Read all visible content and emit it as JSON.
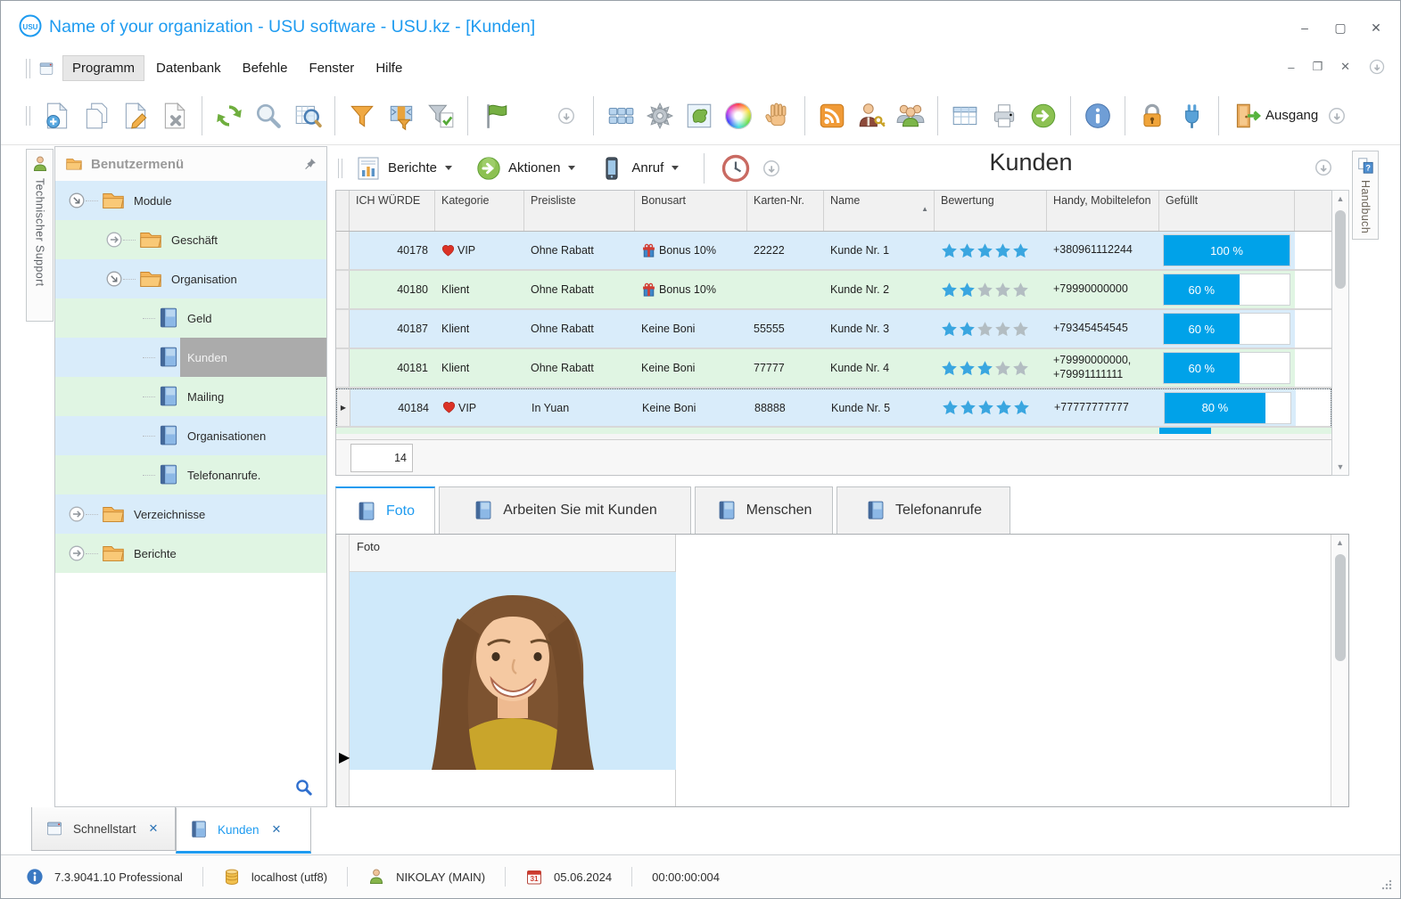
{
  "window": {
    "title": "Name of your organization - USU software - USU.kz - [Kunden]",
    "logo": "USU",
    "controls": {
      "minimize": "–",
      "maximize": "▢",
      "close": "✕"
    }
  },
  "menubar": {
    "items": [
      {
        "label": "Programm",
        "active": true
      },
      {
        "label": "Datenbank"
      },
      {
        "label": "Befehle"
      },
      {
        "label": "Fenster"
      },
      {
        "label": "Hilfe"
      }
    ]
  },
  "toolbar": {
    "items": [
      "new-record",
      "copy-record",
      "edit-record",
      "delete-record",
      "|",
      "refresh",
      "search",
      "search-table",
      "|",
      "filter",
      "filter-columns",
      "filter-apply",
      "|",
      "flag",
      "gap",
      "dropdown-circle",
      "|",
      "tiles",
      "gear",
      "map-image",
      "color-wheel",
      "hand",
      "|",
      "rss-feed",
      "user-key",
      "user-group",
      "|",
      "table-view",
      "print",
      "go-next",
      "|",
      "info",
      "|",
      "lock",
      "plug",
      "|",
      "exit-door"
    ],
    "exit_label": "Ausgang"
  },
  "support_tab": {
    "label": "Technischer Support"
  },
  "handbuch_tab": {
    "label": "Handbuch"
  },
  "sidebar": {
    "header": "Benutzermenü",
    "tree": [
      {
        "label": "Module",
        "icon": "folder",
        "level": 0,
        "expander": "expanded",
        "tone": "blue"
      },
      {
        "label": "Geschäft",
        "icon": "folder",
        "level": 1,
        "expander": "collapsed",
        "tone": "green"
      },
      {
        "label": "Organisation",
        "icon": "folder",
        "level": 1,
        "expander": "expanded",
        "tone": "blue"
      },
      {
        "label": "Geld",
        "icon": "book",
        "level": 2,
        "tone": "green"
      },
      {
        "label": "Kunden",
        "icon": "book",
        "level": 2,
        "tone": "blue",
        "selected": true
      },
      {
        "label": "Mailing",
        "icon": "book",
        "level": 2,
        "tone": "green"
      },
      {
        "label": "Organisationen",
        "icon": "book",
        "level": 2,
        "tone": "blue"
      },
      {
        "label": "Telefonanrufe.",
        "icon": "book",
        "level": 2,
        "tone": "green"
      },
      {
        "label": "Verzeichnisse",
        "icon": "folder",
        "level": 0,
        "expander": "collapsed",
        "tone": "blue"
      },
      {
        "label": "Berichte",
        "icon": "folder",
        "level": 0,
        "expander": "collapsed",
        "tone": "green"
      }
    ]
  },
  "content": {
    "heading": "Kunden",
    "actions": [
      {
        "label": "Berichte",
        "icon": "report"
      },
      {
        "label": "Aktionen",
        "icon": "action-go"
      },
      {
        "label": "Anruf",
        "icon": "phone"
      }
    ],
    "table": {
      "columns": [
        "ICH WÜRDE",
        "Kategorie",
        "Preisliste",
        "Bonusart",
        "Karten-Nr.",
        "Name",
        "Bewertung",
        "Handy, Mobiltelefon",
        "Gefüllt"
      ],
      "sorted_by": "Name",
      "rows": [
        {
          "id": "40178",
          "heart": true,
          "kategorie": "VIP",
          "preisliste": "Ohne Rabatt",
          "gift": true,
          "bonusart": "Bonus 10%",
          "karte": "22222",
          "name": "Kunde Nr. 1",
          "stars": 5,
          "handy": "+380961112244",
          "gefuellt": 100,
          "gefuellt_label": "100 %",
          "tone": "blue"
        },
        {
          "id": "40180",
          "heart": false,
          "kategorie": "Klient",
          "preisliste": "Ohne Rabatt",
          "gift": true,
          "bonusart": "Bonus 10%",
          "karte": "",
          "name": "Kunde Nr. 2",
          "stars": 2,
          "handy": "+79990000000",
          "gefuellt": 60,
          "gefuellt_label": "60 %",
          "tone": "green"
        },
        {
          "id": "40187",
          "heart": false,
          "kategorie": "Klient",
          "preisliste": "Ohne Rabatt",
          "gift": false,
          "bonusart": "Keine Boni",
          "karte": "55555",
          "name": "Kunde Nr. 3",
          "stars": 2,
          "handy": "+79345454545",
          "gefuellt": 60,
          "gefuellt_label": "60 %",
          "tone": "blue"
        },
        {
          "id": "40181",
          "heart": false,
          "kategorie": "Klient",
          "preisliste": "Ohne Rabatt",
          "gift": false,
          "bonusart": "Keine Boni",
          "karte": "77777",
          "name": "Kunde Nr. 4",
          "stars": 3,
          "handy": "+79990000000, +79991111111",
          "gefuellt": 60,
          "gefuellt_label": "60 %",
          "tone": "green"
        },
        {
          "id": "40184",
          "heart": true,
          "kategorie": "VIP",
          "preisliste": "In Yuan",
          "gift": false,
          "bonusart": "Keine Boni",
          "karte": "88888",
          "name": "Kunde Nr. 5",
          "stars": 5,
          "handy": "+77777777777",
          "gefuellt": 80,
          "gefuellt_label": "80 %",
          "tone": "blue",
          "selected": true
        }
      ],
      "partial_row": {
        "gefuellt": 38,
        "tone": "green"
      },
      "footer_count": "14"
    },
    "detail_tabs": [
      {
        "label": "Foto",
        "active": true
      },
      {
        "label": "Arbeiten Sie mit Kunden"
      },
      {
        "label": "Menschen"
      },
      {
        "label": "Telefonanrufe"
      }
    ],
    "photo_panel": {
      "column_header": "Foto"
    }
  },
  "bottom_tabs": [
    {
      "label": "Schnellstart",
      "icon": "window",
      "close": "✕"
    },
    {
      "label": "Kunden",
      "icon": "book",
      "close": "✕",
      "active": true
    }
  ],
  "statusbar": {
    "version": "7.3.9041.10 Professional",
    "database": "localhost (utf8)",
    "user": "NIKOLAY (MAIN)",
    "calendar_day": "31",
    "date": "05.06.2024",
    "timer": "00:00:00:004"
  }
}
